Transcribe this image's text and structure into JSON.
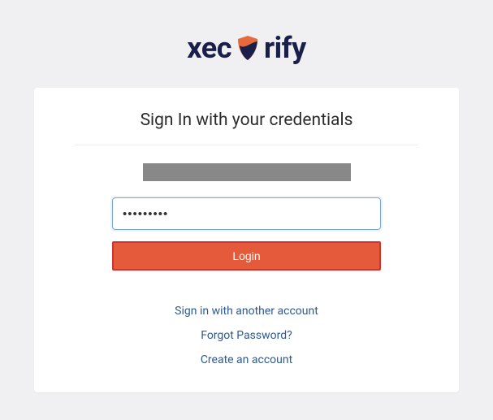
{
  "logo": {
    "prefix": "xec",
    "suffix": "rify"
  },
  "card": {
    "title": "Sign In with your credentials",
    "password_value": "•••••••••",
    "login_label": "Login"
  },
  "links": {
    "another_account": "Sign in with another account",
    "forgot_password": "Forgot Password?",
    "create_account": "Create an account"
  }
}
